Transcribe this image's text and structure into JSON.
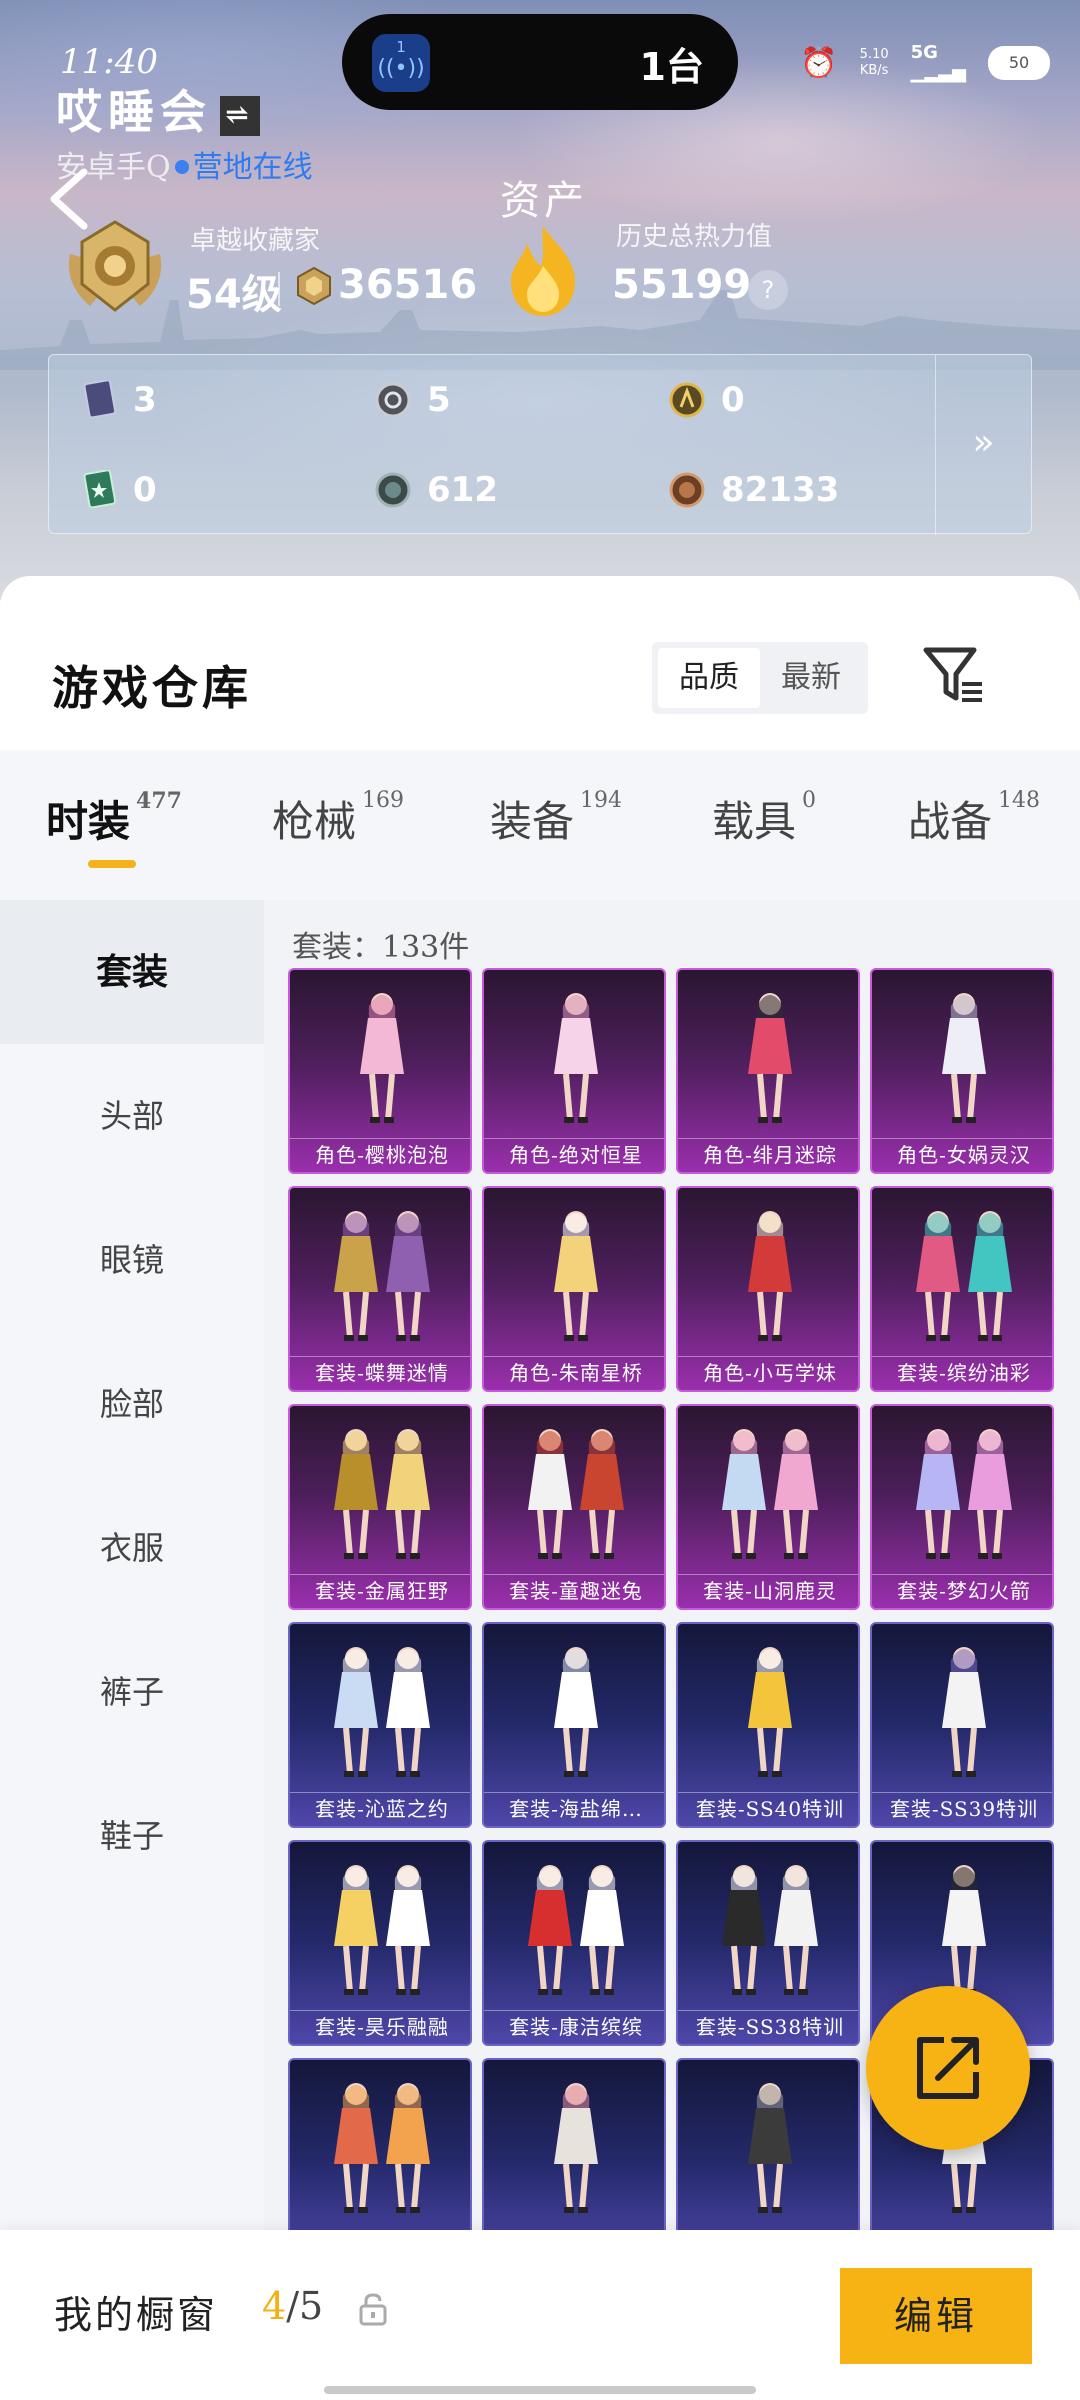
{
  "status_bar": {
    "time": "11:40",
    "island_badge": "1",
    "island_text": "1台",
    "net_speed_value": "5.10",
    "net_speed_unit": "KB/s",
    "network": "5G",
    "battery": "50"
  },
  "profile": {
    "name": "哎睡会",
    "platform": "安卓手Q",
    "online": "营地在线",
    "assets_title": "资产",
    "rank_label": "卓越收藏家",
    "level": "54级",
    "points": "36516",
    "heat_label": "历史总热力值",
    "heat_value": "55199",
    "help": "?"
  },
  "stats": {
    "items": [
      {
        "icon": "card-icon",
        "value": "3"
      },
      {
        "icon": "silver-coin-icon",
        "value": "5"
      },
      {
        "icon": "gold-coin-icon",
        "value": "0"
      },
      {
        "icon": "green-card-icon",
        "value": "0"
      },
      {
        "icon": "token-icon",
        "value": "612"
      },
      {
        "icon": "bronze-coin-icon",
        "value": "82133"
      }
    ],
    "more": "»"
  },
  "warehouse": {
    "title": "游戏仓库",
    "sort_options": [
      "品质",
      "最新"
    ],
    "sort_active": 0
  },
  "tabs": [
    {
      "label": "时装",
      "count": "477"
    },
    {
      "label": "枪械",
      "count": "169"
    },
    {
      "label": "装备",
      "count": "194"
    },
    {
      "label": "载具",
      "count": "0"
    },
    {
      "label": "战备",
      "count": "148"
    }
  ],
  "sidebar": [
    "套装",
    "头部",
    "眼镜",
    "脸部",
    "衣服",
    "裤子",
    "鞋子"
  ],
  "set_count": "套装：133件",
  "items": [
    {
      "label": "角色-樱桃泡泡",
      "tier": "purple"
    },
    {
      "label": "角色-绝对恒星",
      "tier": "purple"
    },
    {
      "label": "角色-绯月迷踪",
      "tier": "purple"
    },
    {
      "label": "角色-女娲灵汉",
      "tier": "purple"
    },
    {
      "label": "套装-蝶舞迷情",
      "tier": "purple"
    },
    {
      "label": "角色-朱南星桥",
      "tier": "purple"
    },
    {
      "label": "角色-小丐学妹",
      "tier": "purple"
    },
    {
      "label": "套装-缤纷油彩",
      "tier": "purple"
    },
    {
      "label": "套装-金属狂野",
      "tier": "purple"
    },
    {
      "label": "套装-童趣迷兔",
      "tier": "purple"
    },
    {
      "label": "套装-山洞鹿灵",
      "tier": "purple"
    },
    {
      "label": "套装-梦幻火箭",
      "tier": "purple"
    },
    {
      "label": "套装-沁蓝之约",
      "tier": "blue"
    },
    {
      "label": "套装-海盐绵…",
      "tier": "blue"
    },
    {
      "label": "套装-SS40特训",
      "tier": "blue"
    },
    {
      "label": "套装-SS39特训",
      "tier": "blue"
    },
    {
      "label": "套装-昊乐融融",
      "tier": "blue"
    },
    {
      "label": "套装-康洁缤缤",
      "tier": "blue"
    },
    {
      "label": "套装-SS38特训",
      "tier": "blue"
    },
    {
      "label": "",
      "tier": "blue"
    },
    {
      "label": "",
      "tier": "blue"
    },
    {
      "label": "",
      "tier": "blue"
    },
    {
      "label": "",
      "tier": "blue"
    },
    {
      "label": "",
      "tier": "blue"
    }
  ],
  "bottom": {
    "showcase_label": "我的橱窗",
    "showcase_used": "4",
    "showcase_total": "/5",
    "edit": "编辑"
  }
}
